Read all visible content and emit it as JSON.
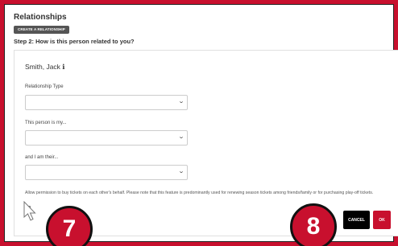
{
  "page": {
    "title": "Relationships",
    "create_button": "CREATE A RELATIONSHIP",
    "step_title": "Step 2: How is this person related to you?"
  },
  "form": {
    "person_name": "Smith, Jack ℹ",
    "relationship_type_label": "Relationship Type",
    "relationship_type_value": "",
    "this_person_label": "This person is my...",
    "this_person_value": "",
    "and_i_am_label": "and I am their...",
    "and_i_am_value": "",
    "permission_note": "Allow permission to buy tickets on each other's behalf. Please note that this feature is predominantly used for renewing season tickets among friends/family or for purchasing play-off tickets.",
    "permission_checked": false
  },
  "actions": {
    "cancel_label": "CANCEL",
    "ok_label": "OK"
  },
  "annotations": {
    "badge_7": "7",
    "badge_8": "8"
  },
  "colors": {
    "accent": "#c8102e",
    "button_dark": "#000000",
    "create_button": "#555555"
  },
  "icons": {
    "select_arrow": "chevron-down-icon",
    "cursor": "cursor-arrow-icon"
  }
}
